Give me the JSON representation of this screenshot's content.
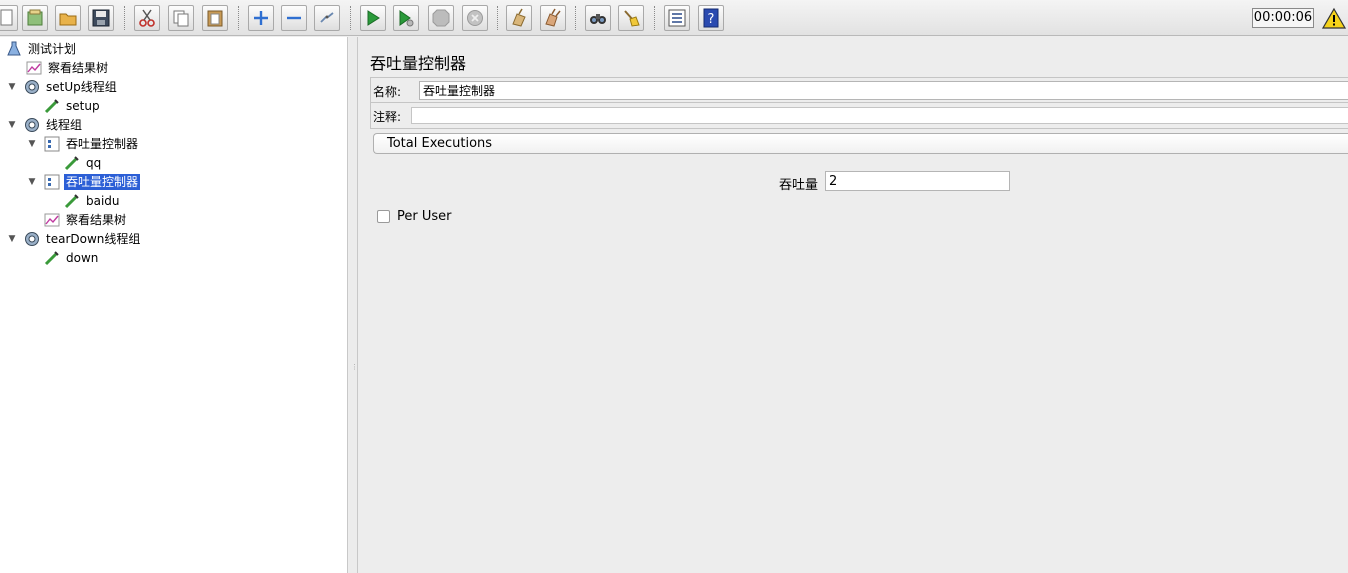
{
  "toolbar": {
    "buttons": [
      "new-icon",
      "templates-icon",
      "open-icon",
      "save-icon",
      "cut-icon",
      "copy-icon",
      "paste-icon",
      "expand-icon",
      "collapse-icon",
      "toggle-icon",
      "start-icon",
      "start-no-pause-icon",
      "stop-icon",
      "shutdown-icon",
      "clear-icon",
      "clear-all-icon",
      "search-icon",
      "reset-search-icon",
      "function-helper-icon",
      "help-icon"
    ],
    "timer": "00:00:06",
    "warning_icon": "warning-icon"
  },
  "tree": {
    "nodes": [
      {
        "label": "测试计划",
        "icon": "test-plan-icon"
      },
      {
        "label": "察看结果树",
        "icon": "listener-icon"
      },
      {
        "label": "setUp线程组",
        "icon": "thread-group-icon"
      },
      {
        "label": "setup",
        "icon": "sampler-icon"
      },
      {
        "label": "线程组",
        "icon": "thread-group-icon"
      },
      {
        "label": "吞吐量控制器",
        "icon": "controller-icon"
      },
      {
        "label": "qq",
        "icon": "sampler-icon"
      },
      {
        "label": "吞吐量控制器",
        "icon": "controller-icon",
        "selected": true
      },
      {
        "label": "baidu",
        "icon": "sampler-icon"
      },
      {
        "label": "察看结果树",
        "icon": "listener-icon"
      },
      {
        "label": "tearDown线程组",
        "icon": "thread-group-icon"
      },
      {
        "label": "down",
        "icon": "sampler-icon"
      }
    ]
  },
  "panel": {
    "title": "吞吐量控制器",
    "name_label": "名称:",
    "name_value": "吞吐量控制器",
    "comment_label": "注释:",
    "comment_value": "",
    "mode_selected": "Total Executions",
    "throughput_label": "吞吐量",
    "throughput_value": "2",
    "per_user_label": "Per User",
    "per_user_checked": false
  }
}
